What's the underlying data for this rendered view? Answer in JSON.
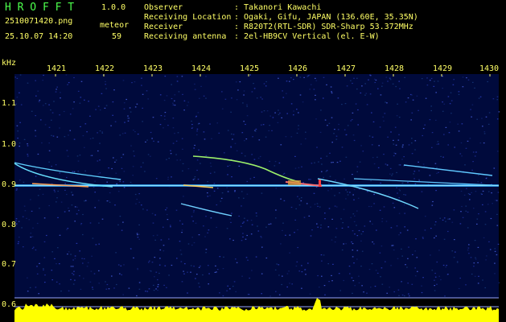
{
  "app": {
    "name": "H R O F F T",
    "version": "1.0.0",
    "filename": "2510071420.png",
    "datetime": "25.10.07 14:20",
    "meteor_label": "meteor",
    "meteor_count": "59"
  },
  "info": {
    "rows": [
      {
        "label": "Observer",
        "value": ": Takanori Kawachi"
      },
      {
        "label": "Receiving Location",
        "value": ": Ogaki, Gifu, JAPAN (136.60E, 35.35N)"
      },
      {
        "label": "Receiver",
        "value": ": R820T2(RTL-SDR) SDR-Sharp 53.372MHz"
      },
      {
        "label": "Receiving antenna",
        "value": ": 2el-HB9CV Vertical (el. E-W)"
      }
    ]
  },
  "axes": {
    "y_unit": "kHz",
    "x_ticks": [
      "1421",
      "1422",
      "1423",
      "1424",
      "1425",
      "1426",
      "1427",
      "1428",
      "1429",
      "1430"
    ],
    "y_ticks": [
      "1.1",
      "1.0",
      "0.9",
      "0.8",
      "0.7",
      "0.6"
    ]
  },
  "colors": {
    "background": "#000000",
    "spectrogram_base": "#000a3c",
    "header_green": "#4cff4c",
    "header_yellow": "#ffff66",
    "level_yellow": "#ffff00",
    "level_cyan": "#00c8ff"
  }
}
